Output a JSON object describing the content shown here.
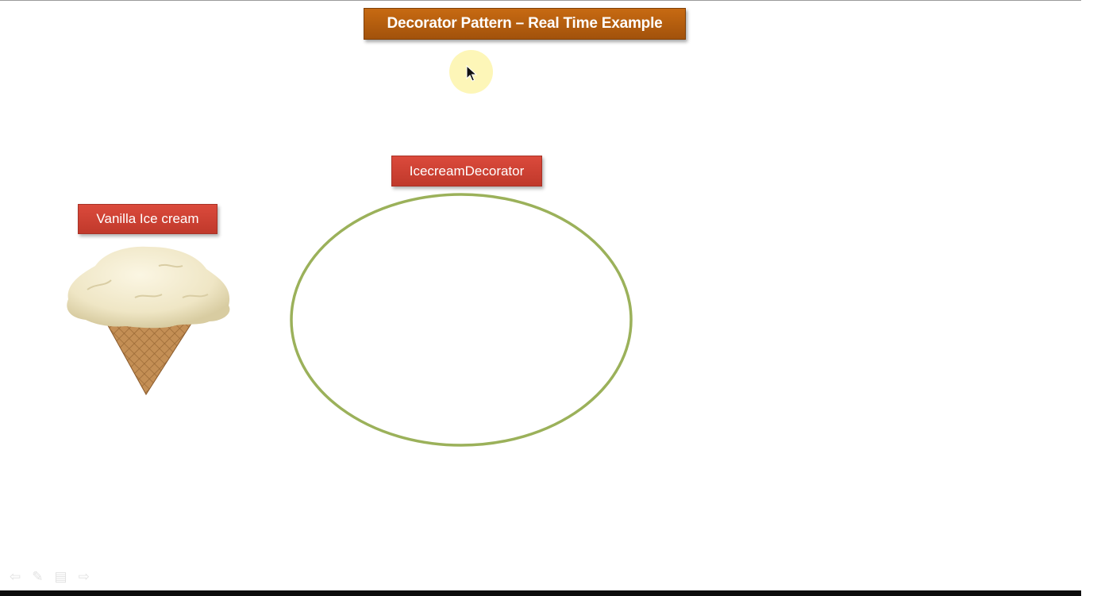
{
  "slide": {
    "title": "Decorator Pattern – Real Time Example",
    "decorator_label": "IcecreamDecorator",
    "base_label": "Vanilla Ice cream"
  },
  "colors": {
    "title_bg": "#b45f0e",
    "label_bg": "#cf3f31",
    "ellipse_stroke": "#9bb15a",
    "cursor_highlight": "#fdf6b8"
  },
  "icons": {
    "nav_prev": "left-arrow-icon",
    "nav_pen": "pen-icon",
    "nav_menu": "menu-icon",
    "nav_next": "right-arrow-icon",
    "pointer": "mouse-pointer-icon"
  }
}
